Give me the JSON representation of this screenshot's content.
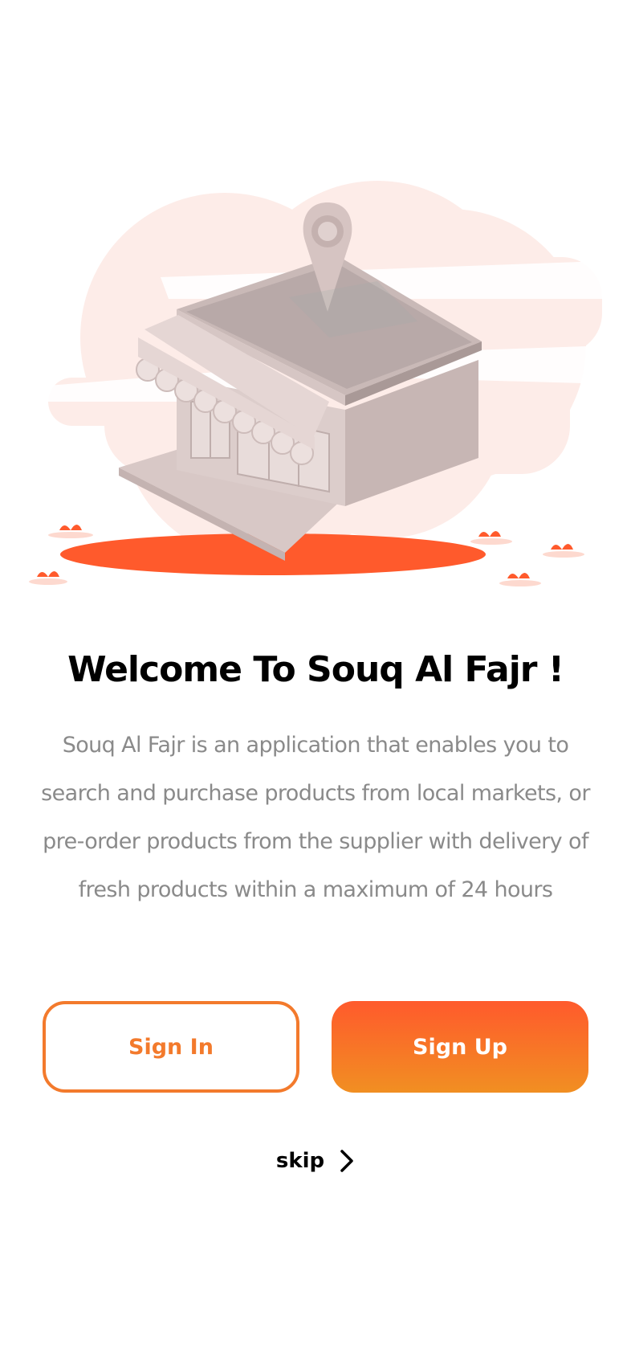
{
  "welcome": {
    "title": "Welcome To Souq Al Fajr !",
    "description": "Souq Al Fajr is an application that enables you to search and purchase products from local markets, or pre-order products from the supplier with delivery of fresh products within a maximum of 24 hours"
  },
  "buttons": {
    "sign_in": "Sign In",
    "sign_up": "Sign Up"
  },
  "skip": {
    "label": "skip",
    "icon": "chevron-right-icon"
  },
  "hero": {
    "icon": "store-location-illustration"
  },
  "colors": {
    "accent": "#f37a2c",
    "gradient_start": "#ff5a2c",
    "gradient_end": "#f18f22",
    "text_primary": "#000000",
    "text_secondary": "#8a8a8a",
    "hero_bg": "#fdebe7"
  }
}
